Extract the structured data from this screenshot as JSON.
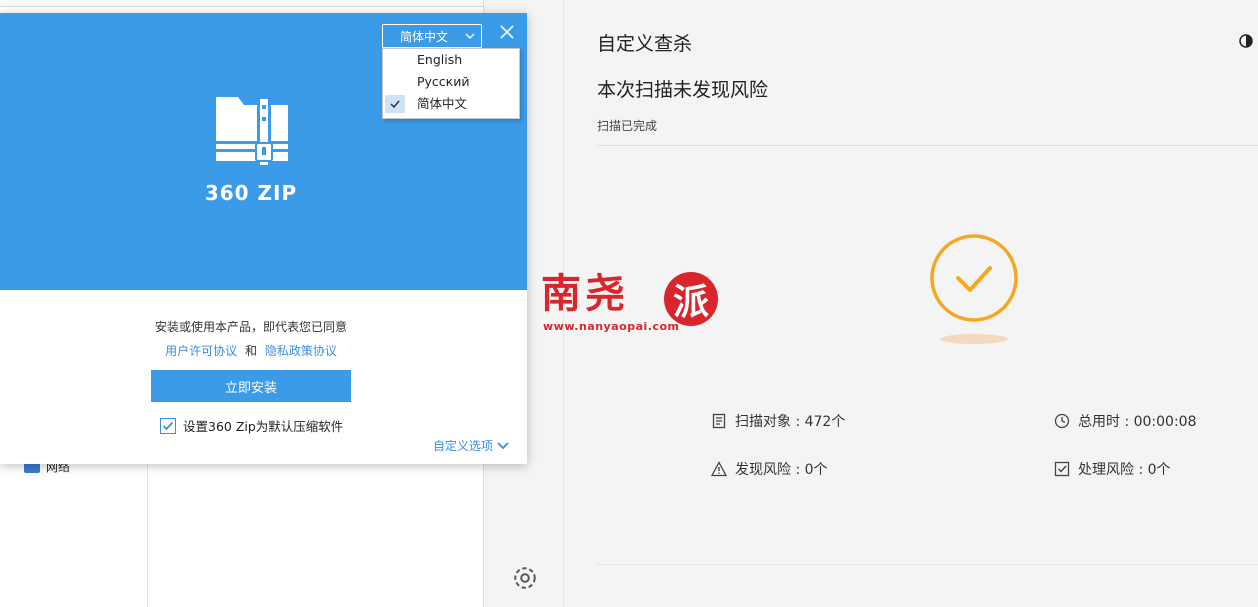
{
  "installer": {
    "product_name": "360 ZIP",
    "language": {
      "selected": "简体中文",
      "options": [
        "English",
        "Русский",
        "简体中文"
      ]
    },
    "agree_text": "安装或使用本产品，即代表您已同意",
    "license_link": "用户许可协议",
    "and_text": "和",
    "privacy_link": "隐私政策协议",
    "install_button": "立即安装",
    "default_option": "设置360 Zip为默认压缩软件",
    "custom_option": "自定义选项"
  },
  "explorer": {
    "network_label": "网络"
  },
  "scan": {
    "title": "自定义查杀",
    "headline": "本次扫描未发现风险",
    "status": "扫描已完成",
    "stats": {
      "objects": "扫描对象 : 472个",
      "elapsed": "总用时 : 00:00:08",
      "found": "发现风险 : 0个",
      "handled": "处理风险 : 0个"
    }
  },
  "watermark": {
    "text": "南尧",
    "circle_char": "派",
    "url": "www.nanyaopai.com"
  },
  "colors": {
    "accent_blue": "#3b9be8",
    "link_blue": "#3a8ee6",
    "success_orange": "#f5a623",
    "watermark_red": "#d9262c"
  }
}
